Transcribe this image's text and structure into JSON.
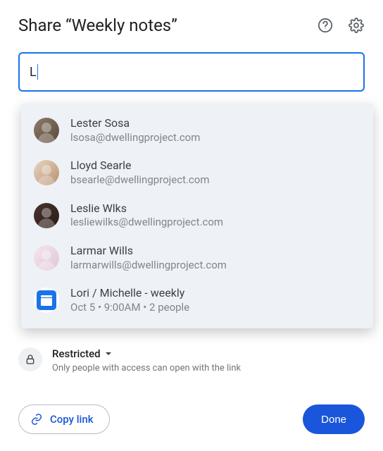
{
  "title": "Share “Weekly notes”",
  "search": {
    "value": "L"
  },
  "suggestions": [
    {
      "name": "Lester Sosa",
      "email": "lsosa@dwellingproject.com",
      "avatar": "av1",
      "type": "person"
    },
    {
      "name": "Lloyd Searle",
      "email": "bsearle@dwellingproject.com",
      "avatar": "av2",
      "type": "person"
    },
    {
      "name": "Leslie Wlks",
      "email": "lesliewilks@dwellingproject.com",
      "avatar": "av3",
      "type": "person"
    },
    {
      "name": "Larmar Wills",
      "email": "larmarwills@dwellingproject.com",
      "avatar": "av4",
      "type": "person"
    },
    {
      "name": "Lori / Michelle - weekly",
      "email": "Oct 5 • 9:00AM • 2 people",
      "avatar": "cal",
      "type": "event"
    }
  ],
  "access": {
    "label": "Restricted",
    "description": "Only people with access can open with the link"
  },
  "buttons": {
    "copy_link": "Copy link",
    "done": "Done"
  }
}
